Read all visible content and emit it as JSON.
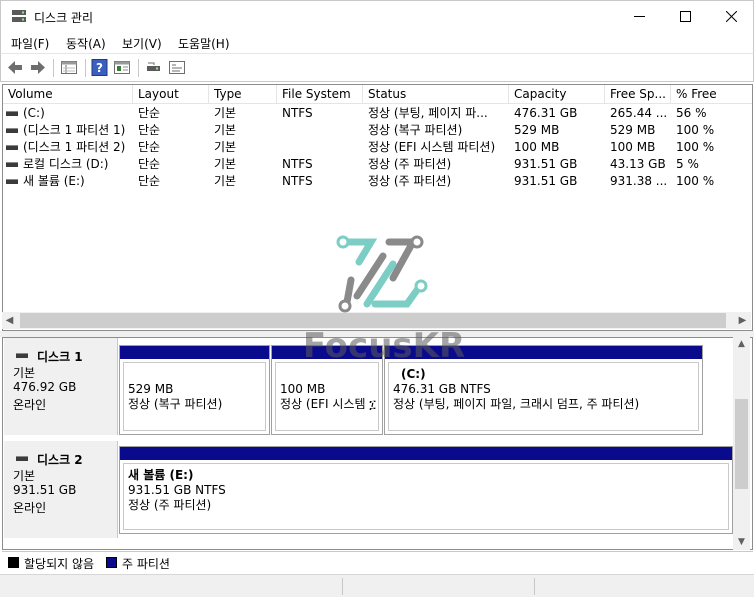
{
  "window": {
    "title": "디스크 관리",
    "app_icon": "disk-management-icon",
    "controls": [
      "minimize-icon",
      "maximize-icon",
      "close-icon"
    ]
  },
  "menu": [
    "파일(F)",
    "동작(A)",
    "보기(V)",
    "도움말(H)"
  ],
  "toolbar": {
    "icons": [
      "back-arrow-icon",
      "forward-arrow-icon",
      "list-view-icon",
      "help-icon",
      "properties-icon",
      "connect-icon",
      "console-icon"
    ]
  },
  "volume_list": {
    "columns": [
      "Volume",
      "Layout",
      "Type",
      "File System",
      "Status",
      "Capacity",
      "Free Sp...",
      "% Free"
    ],
    "rows": [
      {
        "volume": "(C:)",
        "layout": "단순",
        "type": "기본",
        "fs": "NTFS",
        "status": "정상 (부팅, 페이지 파...",
        "capacity": "476.31 GB",
        "free": "265.44 ...",
        "pct": "56 %"
      },
      {
        "volume": "(디스크 1 파티션 1)",
        "layout": "단순",
        "type": "기본",
        "fs": "",
        "status": "정상 (복구 파티션)",
        "capacity": "529 MB",
        "free": "529 MB",
        "pct": "100 %"
      },
      {
        "volume": "(디스크 1 파티션 2)",
        "layout": "단순",
        "type": "기본",
        "fs": "",
        "status": "정상 (EFI 시스템 파티션)",
        "capacity": "100 MB",
        "free": "100 MB",
        "pct": "100 %"
      },
      {
        "volume": "로컬 디스크 (D:)",
        "layout": "단순",
        "type": "기본",
        "fs": "NTFS",
        "status": "정상 (주 파티션)",
        "capacity": "931.51 GB",
        "free": "43.13 GB",
        "pct": "5 %"
      },
      {
        "volume": "새 볼륨 (E:)",
        "layout": "단순",
        "type": "기본",
        "fs": "NTFS",
        "status": "정상 (주 파티션)",
        "capacity": "931.51 GB",
        "free": "931.38 ...",
        "pct": "100 %"
      }
    ]
  },
  "disks": [
    {
      "name": "디스크 1",
      "kind": "기본",
      "size": "476.92 GB",
      "state": "온라인",
      "partitions": [
        {
          "label": "",
          "size": "529 MB",
          "status": "정상 (복구 파티션)"
        },
        {
          "label": "",
          "size": "100 MB",
          "status": "정상 (EFI 시스템 ፲"
        },
        {
          "label": "(C:)",
          "size": "476.31 GB NTFS",
          "status": "정상 (부팅, 페이지 파일, 크래시 덤프, 주 파티션)"
        }
      ]
    },
    {
      "name": "디스크 2",
      "kind": "기본",
      "size": "931.51 GB",
      "state": "온라인",
      "partitions": [
        {
          "label": "새 볼륨  (E:)",
          "size": "931.51 GB NTFS",
          "status": "정상 (주 파티션)"
        }
      ]
    }
  ],
  "legend": [
    {
      "label": "할당되지 않음",
      "color": "#000000"
    },
    {
      "label": "주 파티션",
      "color": "#0a0a8c"
    }
  ],
  "watermark": {
    "text": "FocusKR",
    "colors": [
      "#7ccdc4",
      "#8a8a8a"
    ]
  }
}
